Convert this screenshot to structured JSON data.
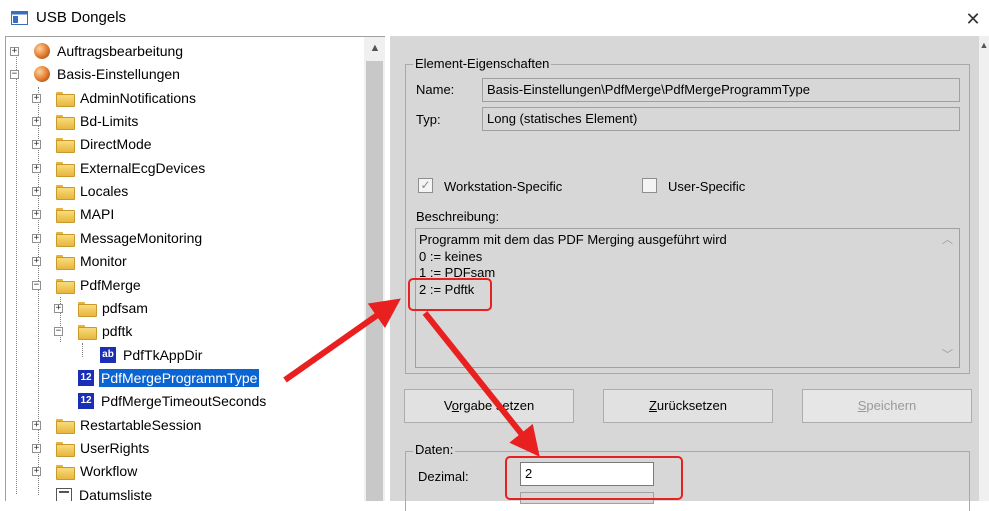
{
  "window": {
    "title": "USB Dongels",
    "close_glyph": "✕"
  },
  "tree": {
    "nodes": [
      {
        "label": "Auftragsbearbeitung",
        "icon": "globe-icon",
        "expander": "+"
      },
      {
        "label": "Basis-Einstellungen",
        "icon": "globe-icon",
        "expander": "-"
      },
      {
        "label": "AdminNotifications",
        "icon": "folder-icon",
        "expander": "+"
      },
      {
        "label": "Bd-Limits",
        "icon": "folder-icon",
        "expander": "+"
      },
      {
        "label": "DirectMode",
        "icon": "folder-icon",
        "expander": "+"
      },
      {
        "label": "ExternalEcgDevices",
        "icon": "folder-icon",
        "expander": "+"
      },
      {
        "label": "Locales",
        "icon": "folder-icon",
        "expander": "+"
      },
      {
        "label": "MAPI",
        "icon": "folder-icon",
        "expander": "+"
      },
      {
        "label": "MessageMonitoring",
        "icon": "folder-icon",
        "expander": "+"
      },
      {
        "label": "Monitor",
        "icon": "folder-icon",
        "expander": "+"
      },
      {
        "label": "PdfMerge",
        "icon": "folder-icon",
        "expander": "-"
      },
      {
        "label": "pdfsam",
        "icon": "folder-icon",
        "expander": "+"
      },
      {
        "label": "pdftk",
        "icon": "folder-icon",
        "expander": "-"
      },
      {
        "label": "PdfTkAppDir",
        "icon": "string-value-icon",
        "icon_text": "ab"
      },
      {
        "label": "PdfMergeProgrammType",
        "icon": "number-value-icon",
        "icon_text": "12",
        "selected": true
      },
      {
        "label": "PdfMergeTimeoutSeconds",
        "icon": "number-value-icon",
        "icon_text": "12"
      },
      {
        "label": "RestartableSession",
        "icon": "folder-icon",
        "expander": "+"
      },
      {
        "label": "UserRights",
        "icon": "folder-icon",
        "expander": "+"
      },
      {
        "label": "Workflow",
        "icon": "folder-icon",
        "expander": "+"
      },
      {
        "label": "Datumsliste",
        "icon": "list-icon"
      }
    ]
  },
  "properties": {
    "group_title": "Element-Eigenschaften",
    "name_label": "Name:",
    "name_value": "Basis-Einstellungen\\PdfMerge\\PdfMergeProgrammType",
    "type_label": "Typ:",
    "type_value": "Long (statisches Element)",
    "workstation_specific_label": "Workstation-Specific",
    "workstation_specific_checked": true,
    "user_specific_label": "User-Specific",
    "user_specific_checked": false,
    "description_label": "Beschreibung:",
    "description_lines": [
      "Programm mit dem das PDF Merging ausgeführt wird",
      "0 := keines",
      "1 := PDFsam",
      "2 := Pdftk"
    ]
  },
  "buttons": {
    "default_pre": "V",
    "default_ul": "o",
    "default_post": "rgabe setzen",
    "reset_pre": "",
    "reset_ul": "Z",
    "reset_post": "urücksetzen",
    "save_pre": "",
    "save_ul": "S",
    "save_post": "peichern"
  },
  "data_section": {
    "group_title": "Daten:",
    "decimal_label": "Dezimal:",
    "decimal_value": "2"
  },
  "colors": {
    "selection": "#0a64d2",
    "annotation_red": "#e82020",
    "panel_bg": "#d7d7d7"
  }
}
